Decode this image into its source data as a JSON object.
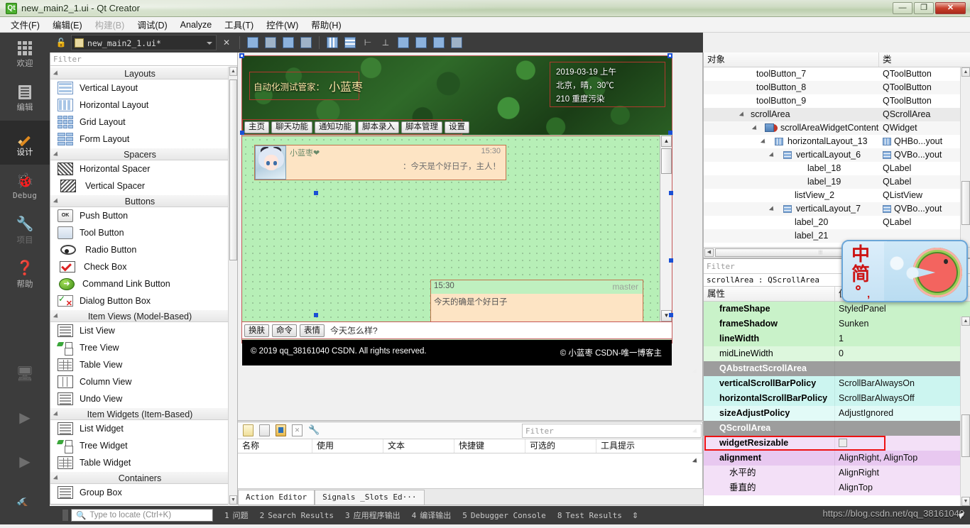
{
  "titlebar": {
    "app_icon": "qt-logo-icon",
    "title": "new_main2_1.ui - Qt Creator",
    "minimize": "—",
    "maximize": "❐",
    "close": "✕"
  },
  "menubar": {
    "items": [
      {
        "label": "文件(F)",
        "disabled": false
      },
      {
        "label": "编辑(E)",
        "disabled": false
      },
      {
        "label": "构建(B)",
        "disabled": true
      },
      {
        "label": "调试(D)",
        "disabled": false
      },
      {
        "label": "Analyze",
        "disabled": false
      },
      {
        "label": "工具(T)",
        "disabled": false
      },
      {
        "label": "控件(W)",
        "disabled": false
      },
      {
        "label": "帮助(H)",
        "disabled": false
      }
    ]
  },
  "modebar": {
    "items": [
      {
        "label": "欢迎",
        "icon": "grid-icon",
        "state": "normal"
      },
      {
        "label": "编辑",
        "icon": "document-icon",
        "state": "normal"
      },
      {
        "label": "设计",
        "icon": "pencil-icon",
        "state": "active"
      },
      {
        "label": "Debug",
        "icon": "bug-icon",
        "state": "normal"
      },
      {
        "label": "项目",
        "icon": "wrench-icon",
        "state": "disabled"
      },
      {
        "label": "帮助",
        "icon": "question-icon",
        "state": "normal"
      }
    ],
    "bottom_icons": [
      "monitor-icon",
      "play-icon",
      "build-run-icon",
      "hammer-icon"
    ]
  },
  "form_toolbar": {
    "lock_icon": "lock-open-icon",
    "filename": "new_main2_1.ui*",
    "close_icon": "✕",
    "buttons": [
      "edit-widgets-icon",
      "edit-signals-icon",
      "edit-buddies-icon",
      "edit-tab-order-icon",
      "layout-horizontally-icon",
      "layout-vertically-icon",
      "layout-splitter-h-icon",
      "layout-splitter-v-icon",
      "layout-form-icon",
      "layout-grid-icon",
      "break-layout-icon",
      "adjust-size-icon"
    ]
  },
  "widgetbox": {
    "filter_placeholder": "Filter",
    "groups": [
      {
        "title": "Layouts",
        "items": [
          {
            "label": "Vertical Layout",
            "icon": "vertical-layout-icon"
          },
          {
            "label": "Horizontal Layout",
            "icon": "horizontal-layout-icon"
          },
          {
            "label": "Grid Layout",
            "icon": "grid-layout-icon"
          },
          {
            "label": "Form Layout",
            "icon": "form-layout-icon"
          }
        ]
      },
      {
        "title": "Spacers",
        "items": [
          {
            "label": "Horizontal Spacer",
            "icon": "horizontal-spacer-icon"
          },
          {
            "label": "Vertical Spacer",
            "icon": "vertical-spacer-icon"
          }
        ]
      },
      {
        "title": "Buttons",
        "items": [
          {
            "label": "Push Button",
            "icon": "push-button-icon"
          },
          {
            "label": "Tool Button",
            "icon": "tool-button-icon"
          },
          {
            "label": "Radio Button",
            "icon": "radio-button-icon"
          },
          {
            "label": "Check Box",
            "icon": "check-box-icon"
          },
          {
            "label": "Command Link Button",
            "icon": "command-link-icon"
          },
          {
            "label": "Dialog Button Box",
            "icon": "dialog-button-box-icon"
          }
        ]
      },
      {
        "title": "Item Views (Model-Based)",
        "items": [
          {
            "label": "List View",
            "icon": "list-view-icon"
          },
          {
            "label": "Tree View",
            "icon": "tree-view-icon"
          },
          {
            "label": "Table View",
            "icon": "table-view-icon"
          },
          {
            "label": "Column View",
            "icon": "column-view-icon"
          },
          {
            "label": "Undo View",
            "icon": "undo-view-icon"
          }
        ]
      },
      {
        "title": "Item Widgets (Item-Based)",
        "items": [
          {
            "label": "List Widget",
            "icon": "list-widget-icon"
          },
          {
            "label": "Tree Widget",
            "icon": "tree-widget-icon"
          },
          {
            "label": "Table Widget",
            "icon": "table-widget-icon"
          }
        ]
      },
      {
        "title": "Containers",
        "items": [
          {
            "label": "Group Box",
            "icon": "group-box-icon"
          }
        ]
      }
    ]
  },
  "canvas": {
    "header": {
      "title_prefix": "自动化测试管家：",
      "title_name": "小蓝枣",
      "weather_line1": "2019-03-19 上午",
      "weather_line2": "北京，晴，30℃",
      "weather_line3": "210 重度污染",
      "tabs": [
        "主页",
        "聊天功能",
        "通知功能",
        "脚本录入",
        "脚本管理",
        "设置"
      ]
    },
    "chat": {
      "message1": {
        "sender": "小蓝枣❤",
        "time": "15:30",
        "text": "：今天是个好日子，主人！"
      },
      "message2": {
        "time": "15:30",
        "sender": "master",
        "text": "今天的确是个好日子"
      }
    },
    "input_bar": {
      "buttons": [
        "换肤",
        "命令",
        "表情"
      ],
      "text": "今天怎么样?"
    },
    "footer": {
      "left": "© 2019 qq_38161040 CSDN. All rights reserved.",
      "right": "© 小蓝枣 CSDN-唯一博客主"
    }
  },
  "action_editor": {
    "toolbar_icons": [
      "new-action-icon",
      "new-from-icon",
      "edit-action-icon",
      "delete-action-icon",
      "configure-icon"
    ],
    "filter_placeholder": "Filter",
    "columns": [
      "名称",
      "使用",
      "文本",
      "快捷键",
      "可选的",
      "工具提示"
    ],
    "rows": [],
    "tabs": [
      {
        "label": "Action Editor",
        "active": true
      },
      {
        "label": "Signals _Slots Ed···",
        "active": false
      }
    ]
  },
  "object_inspector": {
    "columns": [
      "对象",
      "类"
    ],
    "rows": [
      {
        "indent": 5,
        "name": "toolButton_7",
        "class": "QToolButton",
        "expand": false,
        "icon": null
      },
      {
        "indent": 5,
        "name": "toolButton_8",
        "class": "QToolButton",
        "expand": false,
        "icon": null
      },
      {
        "indent": 5,
        "name": "toolButton_9",
        "class": "QToolButton",
        "expand": false,
        "icon": null
      },
      {
        "indent": 4,
        "name": "scrollArea",
        "class": "QScrollArea",
        "expand": true,
        "icon": null,
        "selected": true
      },
      {
        "indent": 5,
        "name": "scrollAreaWidgetContents",
        "class": "QWidget",
        "expand": true,
        "icon": "widget-icon"
      },
      {
        "indent": 6,
        "name": "horizontalLayout_13",
        "class": "QHBo...yout",
        "expand": true,
        "icon": "hbox-icon",
        "class_icon": "hbox-icon"
      },
      {
        "indent": 7,
        "name": "verticalLayout_6",
        "class": "QVBo...yout",
        "expand": true,
        "icon": "vbox-icon",
        "class_icon": "vbox-icon"
      },
      {
        "indent": 8,
        "name": "label_18",
        "class": "QLabel",
        "expand": false,
        "icon": null
      },
      {
        "indent": 8,
        "name": "label_19",
        "class": "QLabel",
        "expand": false,
        "icon": null
      },
      {
        "indent": 7,
        "name": "listView_2",
        "class": "QListView",
        "expand": false,
        "icon": null
      },
      {
        "indent": 6,
        "name": "verticalLayout_7",
        "class": "QVBo...yout",
        "expand": true,
        "icon": "vbox-icon",
        "class_icon": "vbox-icon"
      },
      {
        "indent": 7,
        "name": "label_20",
        "class": "QLabel",
        "expand": false,
        "icon": null
      },
      {
        "indent": 7,
        "name": "label_21",
        "class": "",
        "expand": false,
        "icon": null
      }
    ]
  },
  "property_editor": {
    "filter_placeholder": "Filter",
    "object_line": "scrollArea : QScrollArea",
    "columns": [
      "属性",
      "值"
    ],
    "rows": [
      {
        "name": "frameShape",
        "value": "StyledPanel",
        "style": "green",
        "bold": true
      },
      {
        "name": "frameShadow",
        "value": "Sunken",
        "style": "green",
        "bold": true
      },
      {
        "name": "lineWidth",
        "value": "1",
        "style": "green",
        "bold": true
      },
      {
        "name": "midLineWidth",
        "value": "0",
        "style": "green2",
        "bold": false
      },
      {
        "name": "QAbstractScrollArea",
        "value": "",
        "style": "grouphdr",
        "bold": true,
        "group": true
      },
      {
        "name": "verticalScrollBarPolicy",
        "value": "ScrollBarAlwaysOn",
        "style": "cyan",
        "bold": true
      },
      {
        "name": "horizontalScrollBarPolicy",
        "value": "ScrollBarAlwaysOff",
        "style": "cyan",
        "bold": true
      },
      {
        "name": "sizeAdjustPolicy",
        "value": "AdjustIgnored",
        "style": "cyan2",
        "bold": true
      },
      {
        "name": "QScrollArea",
        "value": "",
        "style": "grouphdr",
        "bold": true,
        "group": true
      },
      {
        "name": "widgetResizable",
        "value": "",
        "style": "purple2",
        "bold": true,
        "checkbox": true,
        "highlighted": true
      },
      {
        "name": "alignment",
        "value": "AlignRight, AlignTop",
        "style": "purple",
        "bold": true,
        "sub": true
      },
      {
        "name": "水平的",
        "value": "AlignRight",
        "style": "purple2",
        "bold": false,
        "child": true
      },
      {
        "name": "垂直的",
        "value": "AlignTop",
        "style": "purple2",
        "bold": false,
        "child": true
      }
    ]
  },
  "ime": {
    "mode_label1": "中",
    "mode_label2": "简",
    "punctuation": "。，",
    "skin": "watermelon-skin"
  },
  "statusbar": {
    "search_placeholder": "Type to locate (Ctrl+K)",
    "search_icon": "search-icon",
    "items": [
      {
        "num": "1",
        "label": "问题"
      },
      {
        "num": "2",
        "label": "Search Results"
      },
      {
        "num": "3",
        "label": "应用程序输出"
      },
      {
        "num": "4",
        "label": "编译输出"
      },
      {
        "num": "5",
        "label": "Debugger Console"
      },
      {
        "num": "8",
        "label": "Test Results"
      }
    ],
    "updown_icon": "⇕"
  },
  "watermark": {
    "url": "https://blog.csdn.net/qq_38161040"
  }
}
